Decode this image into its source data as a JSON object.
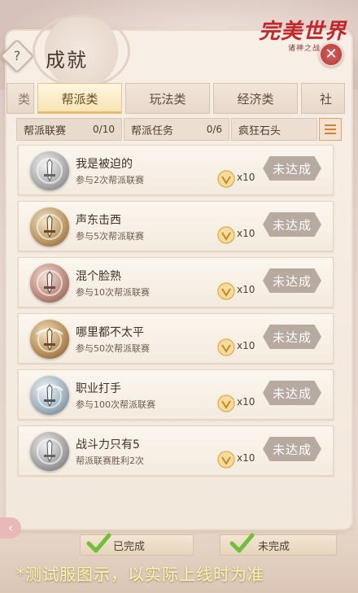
{
  "header": {
    "title": "成就",
    "help_label": "?",
    "close_label": "✕",
    "logo_main": "完美世界",
    "logo_sub": "诸神之战"
  },
  "tabs": [
    {
      "label": "类",
      "state": "partial"
    },
    {
      "label": "帮派类",
      "state": "active"
    },
    {
      "label": "玩法类",
      "state": "normal"
    },
    {
      "label": "经济类",
      "state": "normal"
    },
    {
      "label": "社",
      "state": "partial"
    }
  ],
  "subfilters": [
    {
      "label": "帮派联赛",
      "count": "0/10"
    },
    {
      "label": "帮派任务",
      "count": "0/6"
    },
    {
      "label": "疯狂石头",
      "count": ""
    }
  ],
  "achievements": [
    {
      "title": "我是被迫的",
      "desc": "参与2次帮派联赛",
      "reward": "x10",
      "status": "未达成",
      "badge": "silver"
    },
    {
      "title": "声东击西",
      "desc": "参与5次帮派联赛",
      "reward": "x10",
      "status": "未达成",
      "badge": "bronze"
    },
    {
      "title": "混个脸熟",
      "desc": "参与10次帮派联赛",
      "reward": "x10",
      "status": "未达成",
      "badge": "rose"
    },
    {
      "title": "哪里都不太平",
      "desc": "参与50次帮派联赛",
      "reward": "x10",
      "status": "未达成",
      "badge": "gold"
    },
    {
      "title": "职业打手",
      "desc": "参与100次帮派联赛",
      "reward": "x10",
      "status": "未达成",
      "badge": "steel"
    },
    {
      "title": "战斗力只有5",
      "desc": "帮派联赛胜利2次",
      "reward": "x10",
      "status": "未达成",
      "badge": "gray"
    }
  ],
  "bottom": {
    "completed_label": "已完成",
    "incomplete_label": "未完成",
    "notice": "*测试服图示，以实际上线时为准"
  },
  "colors": {
    "accent": "#e07b2f",
    "status_gray": "#b7aaa0",
    "close_red": "#c6252a",
    "notice_yellow": "#fff7a8"
  }
}
